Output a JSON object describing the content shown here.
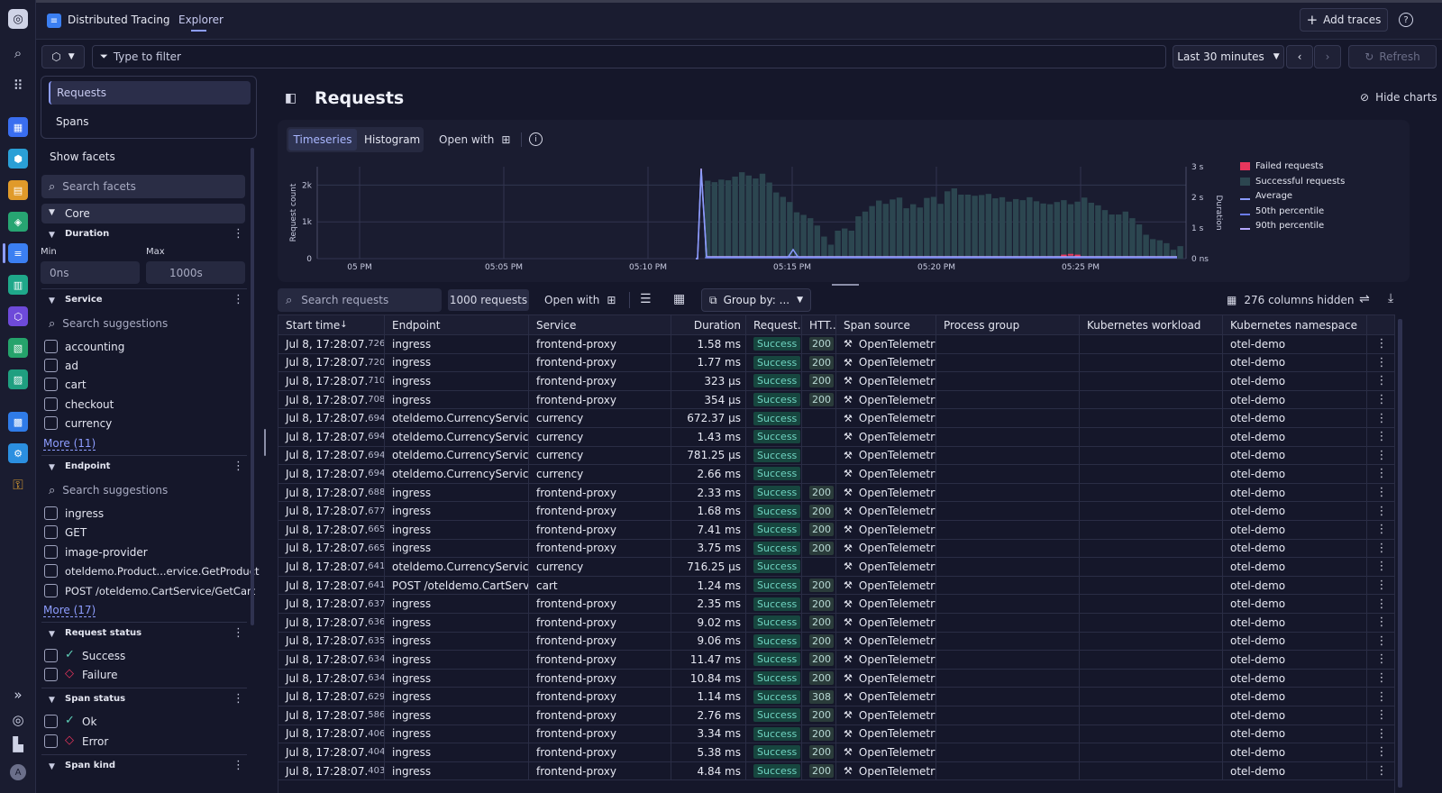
{
  "app": {
    "title": "Distributed Tracing",
    "tab": "Explorer",
    "add_traces": "Add traces",
    "help": "?"
  },
  "filter": {
    "placeholder": "Type to filter",
    "timeframe": "Last 30 minutes",
    "refresh": "Refresh"
  },
  "sidebar": {
    "nav": [
      "Requests",
      "Spans"
    ],
    "show_facets": "Show facets",
    "search_facets": "Search facets",
    "core": "Core",
    "duration": {
      "title": "Duration",
      "min_label": "Min",
      "max_label": "Max",
      "min": "0ns",
      "max": "1000s"
    },
    "service": {
      "title": "Service",
      "search": "Search suggestions",
      "items": [
        "accounting",
        "ad",
        "cart",
        "checkout",
        "currency"
      ],
      "more": "More (11)"
    },
    "endpoint": {
      "title": "Endpoint",
      "search": "Search suggestions",
      "items": [
        "ingress",
        "GET",
        "image-provider",
        "oteldemo.Product...ervice.GetProduct",
        "POST /oteldemo.CartService/GetCart"
      ],
      "more": "More (17)"
    },
    "request_status": {
      "title": "Request status",
      "items": [
        "Success",
        "Failure"
      ]
    },
    "span_status": {
      "title": "Span status",
      "items": [
        "Ok",
        "Error"
      ]
    },
    "span_kind": {
      "title": "Span kind"
    }
  },
  "main": {
    "title": "Requests",
    "hide_charts": "Hide charts",
    "tabs": [
      "Timeseries",
      "Histogram"
    ],
    "open_with": "Open with",
    "search": "Search requests",
    "count": "1000 requests",
    "group_by": "Group by: ...",
    "columns_hidden": "276 columns hidden"
  },
  "chart_data": {
    "type": "bar",
    "ylabel": "Request count",
    "y2label": "Duration",
    "yticks": [
      "0",
      "1k",
      "2k"
    ],
    "y2ticks": [
      "0 ns",
      "1 s",
      "2 s",
      "3 s"
    ],
    "xticks": [
      "05 PM",
      "05:05 PM",
      "05:10 PM",
      "05:15 PM",
      "05:20 PM",
      "05:25 PM"
    ],
    "ylim": [
      0,
      2500
    ],
    "series": [
      {
        "name": "Failed requests",
        "color": "#e8365d",
        "values": [
          0,
          0,
          0,
          0,
          0,
          0,
          0,
          0,
          0,
          0,
          0,
          0,
          0,
          0,
          0,
          0,
          0,
          0,
          0,
          0,
          0,
          0,
          0,
          0,
          0,
          0,
          0,
          0,
          0,
          0,
          0,
          0,
          0,
          0,
          0,
          0,
          0,
          0,
          0,
          0,
          0,
          0,
          0,
          0,
          0,
          0,
          0,
          0,
          0,
          0,
          0,
          0,
          60,
          80,
          60,
          0,
          0,
          0,
          0,
          0,
          0,
          0,
          0,
          0,
          0,
          0,
          0,
          0,
          0,
          0,
          0,
          0,
          0,
          0,
          0,
          0,
          0,
          0
        ]
      },
      {
        "name": "Successful requests",
        "color": "#2c4650",
        "values": [
          2120,
          2080,
          2150,
          2130,
          2230,
          2350,
          2260,
          2180,
          2310,
          2070,
          1800,
          1680,
          1540,
          1260,
          1190,
          1100,
          900,
          600,
          380,
          760,
          820,
          760,
          1150,
          1280,
          1430,
          1580,
          1490,
          1610,
          1660,
          1370,
          1480,
          1390,
          1650,
          1680,
          1490,
          1830,
          1910,
          1740,
          1740,
          1710,
          1730,
          1760,
          1640,
          1670,
          1550,
          1620,
          1590,
          1670,
          1560,
          1500,
          1480,
          1540,
          1590,
          1480,
          1550,
          1660,
          1520,
          1450,
          1320,
          1200,
          1200,
          1280,
          1100,
          930,
          650,
          530,
          500,
          420,
          240,
          340
        ]
      },
      {
        "name": "Average",
        "color": "#8a9bff"
      },
      {
        "name": "50th percentile",
        "color": "#6b7cf0"
      },
      {
        "name": "90th percentile",
        "color": "#b4a8ff"
      }
    ]
  },
  "table": {
    "columns": [
      "Start time",
      "Endpoint",
      "Service",
      "Duration",
      "Request...",
      "HTT...",
      "Span source",
      "Process group",
      "Kubernetes workload",
      "Kubernetes namespace"
    ],
    "rows": [
      [
        "Jul 8, 17:28:07.",
        "726",
        "ingress",
        "frontend-proxy",
        "1.58 ms",
        "Success",
        "200",
        "OpenTelemetry",
        "otel-demo"
      ],
      [
        "Jul 8, 17:28:07.",
        "720",
        "ingress",
        "frontend-proxy",
        "1.77 ms",
        "Success",
        "200",
        "OpenTelemetry",
        "otel-demo"
      ],
      [
        "Jul 8, 17:28:07.",
        "710",
        "ingress",
        "frontend-proxy",
        "323 µs",
        "Success",
        "200",
        "OpenTelemetry",
        "otel-demo"
      ],
      [
        "Jul 8, 17:28:07.",
        "708",
        "ingress",
        "frontend-proxy",
        "354 µs",
        "Success",
        "200",
        "OpenTelemetry",
        "otel-demo"
      ],
      [
        "Jul 8, 17:28:07.",
        "694",
        "oteldemo.CurrencyService....",
        "currency",
        "672.37 µs",
        "Success",
        "",
        "OpenTelemetry",
        "otel-demo"
      ],
      [
        "Jul 8, 17:28:07.",
        "694",
        "oteldemo.CurrencyService....",
        "currency",
        "1.43 ms",
        "Success",
        "",
        "OpenTelemetry",
        "otel-demo"
      ],
      [
        "Jul 8, 17:28:07.",
        "694",
        "oteldemo.CurrencyService....",
        "currency",
        "781.25 µs",
        "Success",
        "",
        "OpenTelemetry",
        "otel-demo"
      ],
      [
        "Jul 8, 17:28:07.",
        "694",
        "oteldemo.CurrencyService....",
        "currency",
        "2.66 ms",
        "Success",
        "",
        "OpenTelemetry",
        "otel-demo"
      ],
      [
        "Jul 8, 17:28:07.",
        "688",
        "ingress",
        "frontend-proxy",
        "2.33 ms",
        "Success",
        "200",
        "OpenTelemetry",
        "otel-demo"
      ],
      [
        "Jul 8, 17:28:07.",
        "677",
        "ingress",
        "frontend-proxy",
        "1.68 ms",
        "Success",
        "200",
        "OpenTelemetry",
        "otel-demo"
      ],
      [
        "Jul 8, 17:28:07.",
        "665",
        "ingress",
        "frontend-proxy",
        "7.41 ms",
        "Success",
        "200",
        "OpenTelemetry",
        "otel-demo"
      ],
      [
        "Jul 8, 17:28:07.",
        "665",
        "ingress",
        "frontend-proxy",
        "3.75 ms",
        "Success",
        "200",
        "OpenTelemetry",
        "otel-demo"
      ],
      [
        "Jul 8, 17:28:07.",
        "641",
        "oteldemo.CurrencyService....",
        "currency",
        "716.25 µs",
        "Success",
        "",
        "OpenTelemetry",
        "otel-demo"
      ],
      [
        "Jul 8, 17:28:07.",
        "641",
        "POST /oteldemo.CartServic...",
        "cart",
        "1.24 ms",
        "Success",
        "200",
        "OpenTelemetry",
        "otel-demo"
      ],
      [
        "Jul 8, 17:28:07.",
        "637",
        "ingress",
        "frontend-proxy",
        "2.35 ms",
        "Success",
        "200",
        "OpenTelemetry",
        "otel-demo"
      ],
      [
        "Jul 8, 17:28:07.",
        "636",
        "ingress",
        "frontend-proxy",
        "9.02 ms",
        "Success",
        "200",
        "OpenTelemetry",
        "otel-demo"
      ],
      [
        "Jul 8, 17:28:07.",
        "635",
        "ingress",
        "frontend-proxy",
        "9.06 ms",
        "Success",
        "200",
        "OpenTelemetry",
        "otel-demo"
      ],
      [
        "Jul 8, 17:28:07.",
        "634",
        "ingress",
        "frontend-proxy",
        "11.47 ms",
        "Success",
        "200",
        "OpenTelemetry",
        "otel-demo"
      ],
      [
        "Jul 8, 17:28:07.",
        "634",
        "ingress",
        "frontend-proxy",
        "10.84 ms",
        "Success",
        "200",
        "OpenTelemetry",
        "otel-demo"
      ],
      [
        "Jul 8, 17:28:07.",
        "629",
        "ingress",
        "frontend-proxy",
        "1.14 ms",
        "Success",
        "308",
        "OpenTelemetry",
        "otel-demo"
      ],
      [
        "Jul 8, 17:28:07.",
        "586",
        "ingress",
        "frontend-proxy",
        "2.76 ms",
        "Success",
        "200",
        "OpenTelemetry",
        "otel-demo"
      ],
      [
        "Jul 8, 17:28:07.",
        "406",
        "ingress",
        "frontend-proxy",
        "3.34 ms",
        "Success",
        "200",
        "OpenTelemetry",
        "otel-demo"
      ],
      [
        "Jul 8, 17:28:07.",
        "404",
        "ingress",
        "frontend-proxy",
        "5.38 ms",
        "Success",
        "200",
        "OpenTelemetry",
        "otel-demo"
      ],
      [
        "Jul 8, 17:28:07.",
        "403",
        "ingress",
        "frontend-proxy",
        "4.84 ms",
        "Success",
        "200",
        "OpenTelemetry",
        "otel-demo"
      ]
    ]
  }
}
